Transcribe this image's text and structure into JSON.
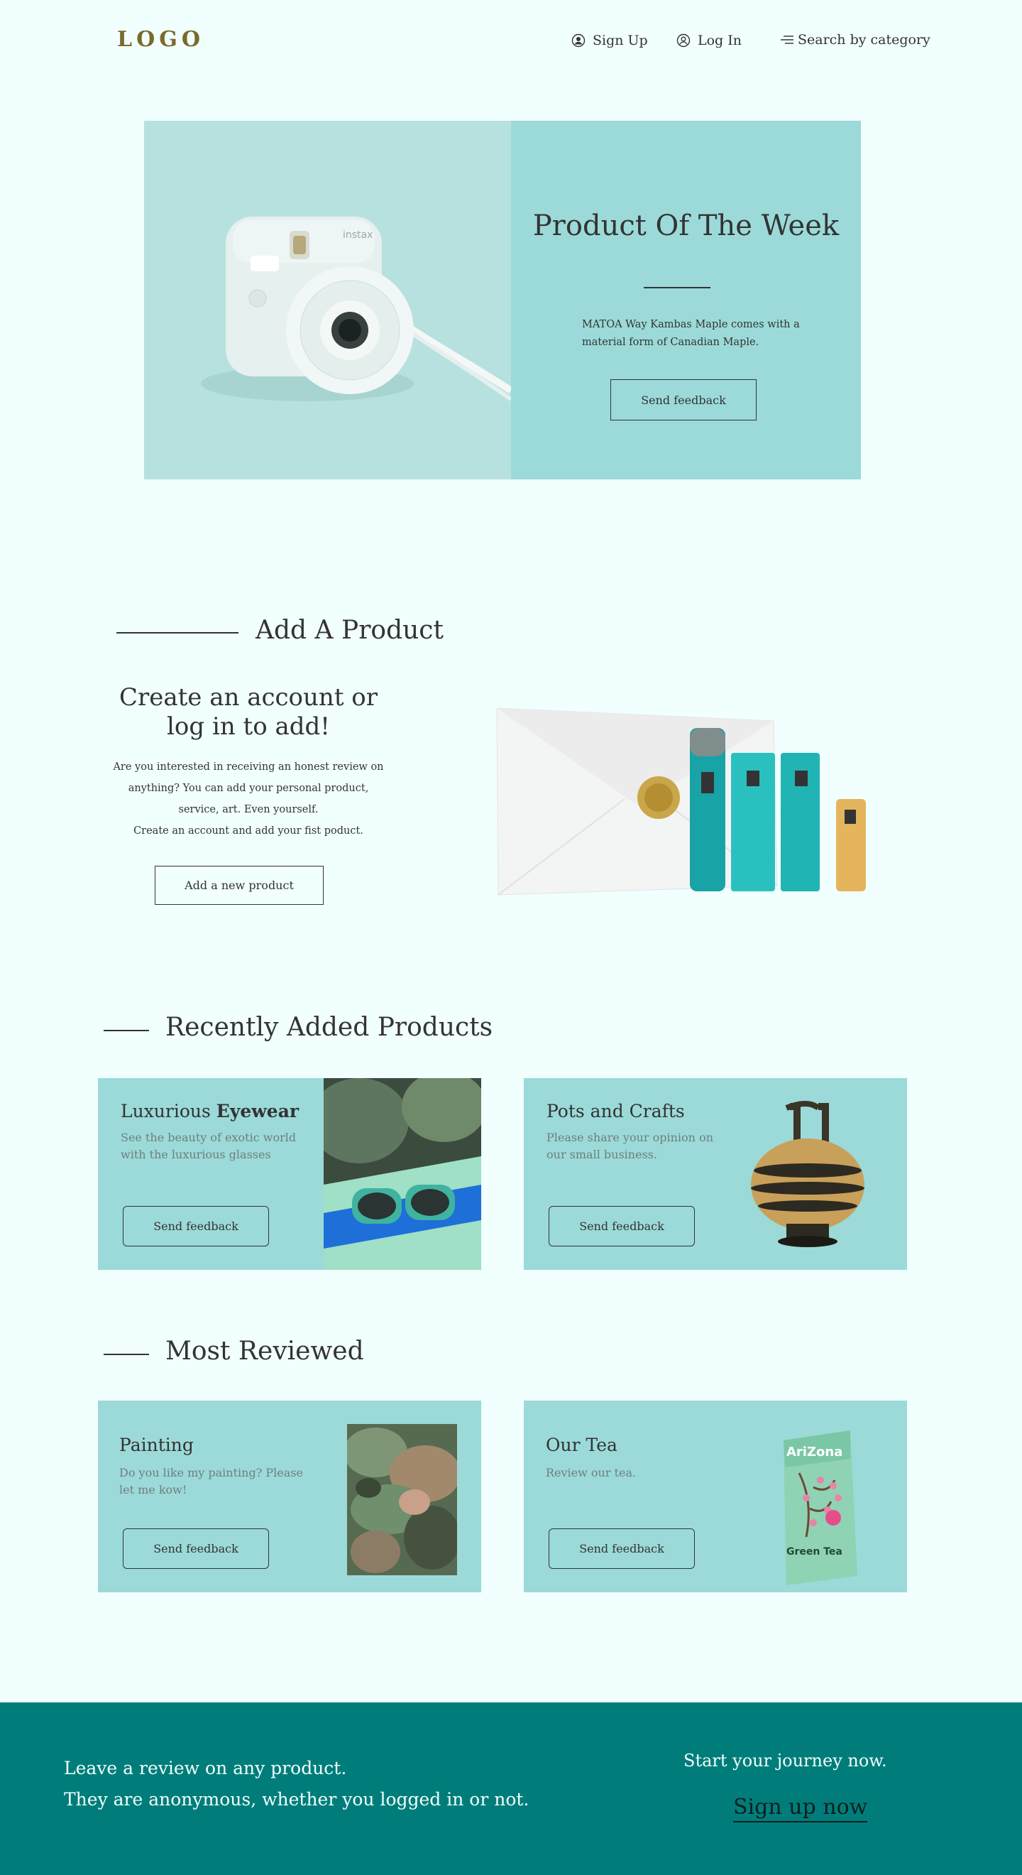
{
  "header": {
    "logo": "LOGO",
    "nav": {
      "signup_label": "Sign Up",
      "login_label": "Log In",
      "search_label": "Search by category"
    }
  },
  "hero": {
    "title": "Product Of The Week",
    "description": "MATOA Way Kambas Maple comes with a material form of Canadian Maple.",
    "button_label": "Send feedback",
    "image_icon": "instant-camera-image"
  },
  "add_product": {
    "section_title": "Add A Product",
    "heading": "Create an account or log in to add!",
    "text_lines": [
      "Are you interested in receiving an honest review on",
      "anything? You can add your personal product,",
      "service, art. Even yourself.",
      "Create an account and add your fist poduct."
    ],
    "button_label": "Add a new product",
    "image_icon": "cosmetics-gift-set-image"
  },
  "recent": {
    "section_title": "Recently Added Products",
    "cards": [
      {
        "title_regular": "Luxurious ",
        "title_bold": "Eyewear",
        "description": "See the beauty of exotic world with the luxurious glasses",
        "button_label": "Send feedback",
        "image_icon": "sunglasses-image"
      },
      {
        "title": "Pots and Crafts",
        "description": "Please share your opinion on our small business.",
        "button_label": "Send feedback",
        "image_icon": "ancient-jar-image"
      }
    ]
  },
  "most_reviewed": {
    "section_title": "Most Reviewed",
    "cards": [
      {
        "title": "Painting",
        "description": "Do you like my painting? Please let me kow!",
        "button_label": "Send feedback",
        "image_icon": "abstract-painting-image"
      },
      {
        "title": "Our Tea",
        "description": "Review our tea.",
        "button_label": "Send feedback",
        "image_icon": "tea-carton-image",
        "image_brand": "AriZona",
        "image_product": "Green Tea"
      }
    ]
  },
  "footer": {
    "line1": "Leave a review on any product.",
    "line2": "They are anonymous, whether you logged in or not.",
    "journey": "Start your journey now.",
    "signup_link": "Sign up now"
  },
  "colors": {
    "background": "#F1FFFE",
    "card": "#9BDAD8",
    "footer": "#007D7A",
    "logo": "#7A6A2A"
  }
}
